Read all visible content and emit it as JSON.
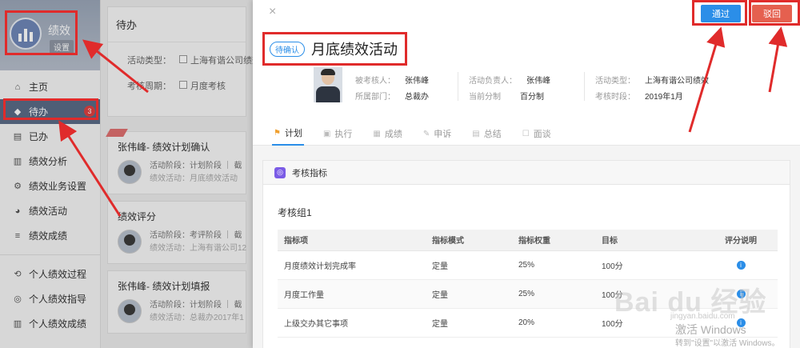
{
  "sidebar": {
    "profile_name": "绩效",
    "profile_tag": "设置",
    "items": [
      {
        "label": "主页",
        "icon": "home-icon",
        "glyph": "⌂"
      },
      {
        "label": "待办",
        "icon": "tag-icon",
        "glyph": "◆",
        "badge": "3"
      },
      {
        "label": "已办",
        "icon": "doc-icon",
        "glyph": "▤"
      },
      {
        "label": "绩效分析",
        "icon": "bar-chart-icon",
        "glyph": "▥"
      },
      {
        "label": "绩效业务设置",
        "icon": "settings-doc-icon",
        "glyph": "⚙"
      },
      {
        "label": "绩效活动",
        "icon": "pie-icon",
        "glyph": "◕"
      },
      {
        "label": "绩效成绩",
        "icon": "list-icon",
        "glyph": "≡"
      },
      {
        "label": "个人绩效过程",
        "icon": "refresh-icon",
        "glyph": "⟲"
      },
      {
        "label": "个人绩效指导",
        "icon": "compass-icon",
        "glyph": "◎"
      },
      {
        "label": "个人绩效成绩",
        "icon": "chart-icon",
        "glyph": "▥"
      }
    ]
  },
  "middle": {
    "header": "待办",
    "filter_type_label": "活动类型：",
    "filter_type_value": "上海有谐公司绩效",
    "filter_period_label": "考核周期：",
    "filter_period_value": "月度考核",
    "items": [
      {
        "title": "张伟峰- 绩效计划确认",
        "line1": "活动阶段：计划阶段 ｜ 截",
        "line2": "绩效活动：月底绩效活动"
      },
      {
        "title": "绩效评分",
        "line1": "活动阶段：考评阶段 ｜ 截",
        "line2": "绩效活动：上海有谐公司12"
      },
      {
        "title": "张伟峰- 绩效计划填报",
        "line1": "活动阶段：计划阶段 ｜ 截",
        "line2": "绩效活动：总裁办2017年1"
      }
    ]
  },
  "drawer": {
    "close": "×",
    "pass_button": "通过",
    "reject_button": "驳回",
    "status_tag": "待确认",
    "title": "月底绩效活动",
    "info": {
      "assessee_label": "被考核人：",
      "assessee": "张伟峰",
      "dept_label": "所属部门：",
      "dept": "总裁办",
      "owner_label": "活动负责人：",
      "owner": "张伟峰",
      "score_label": "当前分制",
      "score": "百分制",
      "type_label": "活动类型：",
      "type": "上海有谐公司绩效",
      "period_label": "考核时段：",
      "period": "2019年1月"
    },
    "tabs": [
      {
        "label": "计划",
        "glyph": "⚑",
        "active": true
      },
      {
        "label": "执行",
        "glyph": "▣"
      },
      {
        "label": "成绩",
        "glyph": "▦"
      },
      {
        "label": "申诉",
        "glyph": "✎"
      },
      {
        "label": "总结",
        "glyph": "▤"
      },
      {
        "label": "面谈",
        "glyph": "☐"
      }
    ],
    "panel_title": "考核指标",
    "group_name": "考核组1",
    "table": {
      "headers": [
        "指标项",
        "指标模式",
        "指标权重",
        "目标",
        "评分说明"
      ],
      "rows": [
        [
          "月度绩效计划完成率",
          "定量",
          "25%",
          "100分"
        ],
        [
          "月度工作量",
          "定量",
          "25%",
          "100分"
        ],
        [
          "上级交办其它事项",
          "定量",
          "20%",
          "100分"
        ]
      ]
    }
  },
  "watermark": {
    "baidu": "Bai du 经验",
    "url": "jingyan.baidu.com",
    "win_line1": "激活 Windows",
    "win_line2": "转到\"设置\"以激活 Windows。"
  }
}
